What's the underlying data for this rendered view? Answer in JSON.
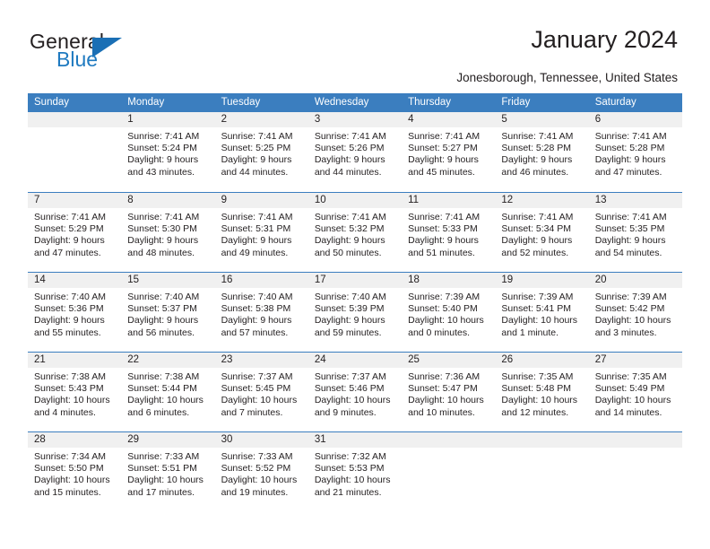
{
  "brand": {
    "name_top": "General",
    "name_bottom": "Blue"
  },
  "header": {
    "title": "January 2024",
    "subtitle": "Jonesborough, Tennessee, United States"
  },
  "colors": {
    "header_blue": "#3b7ebf",
    "logo_blue": "#1f7ac0",
    "day_band_gray": "#f0f0f0",
    "text": "#231f20"
  },
  "weekdays": [
    "Sunday",
    "Monday",
    "Tuesday",
    "Wednesday",
    "Thursday",
    "Friday",
    "Saturday"
  ],
  "weeks": [
    [
      {
        "day": "",
        "sunrise": "",
        "sunset": "",
        "daylight": "",
        "empty": true
      },
      {
        "day": "1",
        "sunrise": "Sunrise: 7:41 AM",
        "sunset": "Sunset: 5:24 PM",
        "daylight": "Daylight: 9 hours and 43 minutes."
      },
      {
        "day": "2",
        "sunrise": "Sunrise: 7:41 AM",
        "sunset": "Sunset: 5:25 PM",
        "daylight": "Daylight: 9 hours and 44 minutes."
      },
      {
        "day": "3",
        "sunrise": "Sunrise: 7:41 AM",
        "sunset": "Sunset: 5:26 PM",
        "daylight": "Daylight: 9 hours and 44 minutes."
      },
      {
        "day": "4",
        "sunrise": "Sunrise: 7:41 AM",
        "sunset": "Sunset: 5:27 PM",
        "daylight": "Daylight: 9 hours and 45 minutes."
      },
      {
        "day": "5",
        "sunrise": "Sunrise: 7:41 AM",
        "sunset": "Sunset: 5:28 PM",
        "daylight": "Daylight: 9 hours and 46 minutes."
      },
      {
        "day": "6",
        "sunrise": "Sunrise: 7:41 AM",
        "sunset": "Sunset: 5:28 PM",
        "daylight": "Daylight: 9 hours and 47 minutes."
      }
    ],
    [
      {
        "day": "7",
        "sunrise": "Sunrise: 7:41 AM",
        "sunset": "Sunset: 5:29 PM",
        "daylight": "Daylight: 9 hours and 47 minutes."
      },
      {
        "day": "8",
        "sunrise": "Sunrise: 7:41 AM",
        "sunset": "Sunset: 5:30 PM",
        "daylight": "Daylight: 9 hours and 48 minutes."
      },
      {
        "day": "9",
        "sunrise": "Sunrise: 7:41 AM",
        "sunset": "Sunset: 5:31 PM",
        "daylight": "Daylight: 9 hours and 49 minutes."
      },
      {
        "day": "10",
        "sunrise": "Sunrise: 7:41 AM",
        "sunset": "Sunset: 5:32 PM",
        "daylight": "Daylight: 9 hours and 50 minutes."
      },
      {
        "day": "11",
        "sunrise": "Sunrise: 7:41 AM",
        "sunset": "Sunset: 5:33 PM",
        "daylight": "Daylight: 9 hours and 51 minutes."
      },
      {
        "day": "12",
        "sunrise": "Sunrise: 7:41 AM",
        "sunset": "Sunset: 5:34 PM",
        "daylight": "Daylight: 9 hours and 52 minutes."
      },
      {
        "day": "13",
        "sunrise": "Sunrise: 7:41 AM",
        "sunset": "Sunset: 5:35 PM",
        "daylight": "Daylight: 9 hours and 54 minutes."
      }
    ],
    [
      {
        "day": "14",
        "sunrise": "Sunrise: 7:40 AM",
        "sunset": "Sunset: 5:36 PM",
        "daylight": "Daylight: 9 hours and 55 minutes."
      },
      {
        "day": "15",
        "sunrise": "Sunrise: 7:40 AM",
        "sunset": "Sunset: 5:37 PM",
        "daylight": "Daylight: 9 hours and 56 minutes."
      },
      {
        "day": "16",
        "sunrise": "Sunrise: 7:40 AM",
        "sunset": "Sunset: 5:38 PM",
        "daylight": "Daylight: 9 hours and 57 minutes."
      },
      {
        "day": "17",
        "sunrise": "Sunrise: 7:40 AM",
        "sunset": "Sunset: 5:39 PM",
        "daylight": "Daylight: 9 hours and 59 minutes."
      },
      {
        "day": "18",
        "sunrise": "Sunrise: 7:39 AM",
        "sunset": "Sunset: 5:40 PM",
        "daylight": "Daylight: 10 hours and 0 minutes."
      },
      {
        "day": "19",
        "sunrise": "Sunrise: 7:39 AM",
        "sunset": "Sunset: 5:41 PM",
        "daylight": "Daylight: 10 hours and 1 minute."
      },
      {
        "day": "20",
        "sunrise": "Sunrise: 7:39 AM",
        "sunset": "Sunset: 5:42 PM",
        "daylight": "Daylight: 10 hours and 3 minutes."
      }
    ],
    [
      {
        "day": "21",
        "sunrise": "Sunrise: 7:38 AM",
        "sunset": "Sunset: 5:43 PM",
        "daylight": "Daylight: 10 hours and 4 minutes."
      },
      {
        "day": "22",
        "sunrise": "Sunrise: 7:38 AM",
        "sunset": "Sunset: 5:44 PM",
        "daylight": "Daylight: 10 hours and 6 minutes."
      },
      {
        "day": "23",
        "sunrise": "Sunrise: 7:37 AM",
        "sunset": "Sunset: 5:45 PM",
        "daylight": "Daylight: 10 hours and 7 minutes."
      },
      {
        "day": "24",
        "sunrise": "Sunrise: 7:37 AM",
        "sunset": "Sunset: 5:46 PM",
        "daylight": "Daylight: 10 hours and 9 minutes."
      },
      {
        "day": "25",
        "sunrise": "Sunrise: 7:36 AM",
        "sunset": "Sunset: 5:47 PM",
        "daylight": "Daylight: 10 hours and 10 minutes."
      },
      {
        "day": "26",
        "sunrise": "Sunrise: 7:35 AM",
        "sunset": "Sunset: 5:48 PM",
        "daylight": "Daylight: 10 hours and 12 minutes."
      },
      {
        "day": "27",
        "sunrise": "Sunrise: 7:35 AM",
        "sunset": "Sunset: 5:49 PM",
        "daylight": "Daylight: 10 hours and 14 minutes."
      }
    ],
    [
      {
        "day": "28",
        "sunrise": "Sunrise: 7:34 AM",
        "sunset": "Sunset: 5:50 PM",
        "daylight": "Daylight: 10 hours and 15 minutes."
      },
      {
        "day": "29",
        "sunrise": "Sunrise: 7:33 AM",
        "sunset": "Sunset: 5:51 PM",
        "daylight": "Daylight: 10 hours and 17 minutes."
      },
      {
        "day": "30",
        "sunrise": "Sunrise: 7:33 AM",
        "sunset": "Sunset: 5:52 PM",
        "daylight": "Daylight: 10 hours and 19 minutes."
      },
      {
        "day": "31",
        "sunrise": "Sunrise: 7:32 AM",
        "sunset": "Sunset: 5:53 PM",
        "daylight": "Daylight: 10 hours and 21 minutes."
      },
      {
        "day": "",
        "sunrise": "",
        "sunset": "",
        "daylight": "",
        "empty": true
      },
      {
        "day": "",
        "sunrise": "",
        "sunset": "",
        "daylight": "",
        "empty": true
      },
      {
        "day": "",
        "sunrise": "",
        "sunset": "",
        "daylight": "",
        "empty": true
      }
    ]
  ]
}
